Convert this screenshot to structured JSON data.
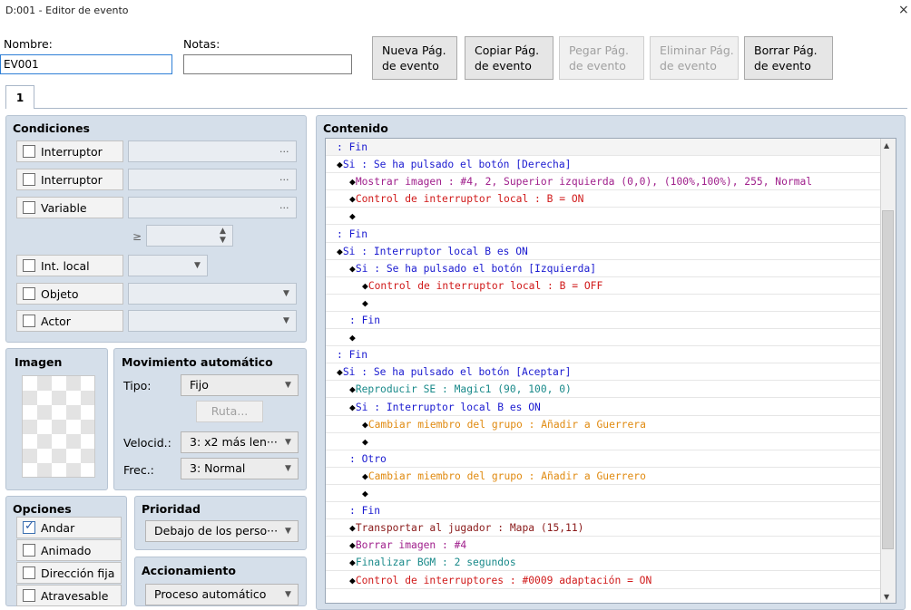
{
  "window": {
    "title": "D:001 - Editor de evento",
    "close": "×"
  },
  "header": {
    "name_label": "Nombre:",
    "name_value": "EV001",
    "notes_label": "Notas:",
    "notes_value": ""
  },
  "page_buttons": [
    {
      "l1": "Nueva Pág.",
      "l2": "de evento",
      "enabled": true
    },
    {
      "l1": "Copiar Pág.",
      "l2": "de evento",
      "enabled": true
    },
    {
      "l1": "Pegar Pág.",
      "l2": "de evento",
      "enabled": false
    },
    {
      "l1": "Eliminar Pág.",
      "l2": "de evento",
      "enabled": false
    },
    {
      "l1": "Borrar Pág.",
      "l2": "de evento",
      "enabled": true
    }
  ],
  "tabs": [
    "1"
  ],
  "conditions": {
    "title": "Condiciones",
    "switch1": "Interruptor",
    "switch2": "Interruptor",
    "variable": "Variable",
    "gte": "≥",
    "self_switch": "Int. local",
    "item": "Objeto",
    "actor": "Actor",
    "ellipsis": "···"
  },
  "image": {
    "title": "Imagen"
  },
  "autonomous": {
    "title": "Movimiento automático",
    "type_label": "Tipo:",
    "type_value": "Fijo",
    "route": "Ruta...",
    "speed_label": "Velocid.:",
    "speed_value": "3: x2 más len···",
    "freq_label": "Frec.:",
    "freq_value": "3: Normal"
  },
  "options": {
    "title": "Opciones",
    "walk": "Andar",
    "walk_checked": true,
    "stepping": "Animado",
    "direction_fix": "Dirección fija",
    "through": "Atravesable"
  },
  "priority": {
    "title": "Prioridad",
    "value": "Debajo de los perso···"
  },
  "trigger": {
    "title": "Accionamiento",
    "value": "Proceso automático"
  },
  "contents": {
    "title": "Contenido",
    "colors": {
      "flow": "#1a1ad0",
      "picture": "#a0208c",
      "switch": "#d01a1a",
      "audio": "#1a8a8a",
      "party": "#e08a10",
      "transfer": "#8a1a1a"
    },
    "rows": [
      {
        "indent": 0,
        "diamond": false,
        "text": ": Fin",
        "color": "flow"
      },
      {
        "indent": 0,
        "diamond": true,
        "text": "Si : Se ha pulsado el botón [Derecha]",
        "color": "flow"
      },
      {
        "indent": 1,
        "diamond": true,
        "text": "Mostrar imagen : #4, 2, Superior izquierda (0,0), (100%,100%), 255, Normal",
        "color": "picture"
      },
      {
        "indent": 1,
        "diamond": true,
        "text": "Control de interruptor local : B = ON",
        "color": "switch"
      },
      {
        "indent": 1,
        "diamond": true,
        "text": "",
        "color": "flow"
      },
      {
        "indent": 0,
        "diamond": false,
        "text": ": Fin",
        "color": "flow"
      },
      {
        "indent": 0,
        "diamond": true,
        "text": "Si : Interruptor local B es ON",
        "color": "flow"
      },
      {
        "indent": 1,
        "diamond": true,
        "text": "Si : Se ha pulsado el botón [Izquierda]",
        "color": "flow"
      },
      {
        "indent": 2,
        "diamond": true,
        "text": "Control de interruptor local : B = OFF",
        "color": "switch"
      },
      {
        "indent": 2,
        "diamond": true,
        "text": "",
        "color": "flow"
      },
      {
        "indent": 1,
        "diamond": false,
        "text": ": Fin",
        "color": "flow"
      },
      {
        "indent": 1,
        "diamond": true,
        "text": "",
        "color": "flow"
      },
      {
        "indent": 0,
        "diamond": false,
        "text": ": Fin",
        "color": "flow"
      },
      {
        "indent": 0,
        "diamond": true,
        "text": "Si : Se ha pulsado el botón [Aceptar]",
        "color": "flow"
      },
      {
        "indent": 1,
        "diamond": true,
        "text": "Reproducir SE : Magic1 (90, 100, 0)",
        "color": "audio"
      },
      {
        "indent": 1,
        "diamond": true,
        "text": "Si : Interruptor local B es ON",
        "color": "flow"
      },
      {
        "indent": 2,
        "diamond": true,
        "text": "Cambiar miembro del grupo : Añadir a Guerrera",
        "color": "party"
      },
      {
        "indent": 2,
        "diamond": true,
        "text": "",
        "color": "flow"
      },
      {
        "indent": 1,
        "diamond": false,
        "text": ": Otro",
        "color": "flow"
      },
      {
        "indent": 2,
        "diamond": true,
        "text": "Cambiar miembro del grupo : Añadir a Guerrero",
        "color": "party"
      },
      {
        "indent": 2,
        "diamond": true,
        "text": "",
        "color": "flow"
      },
      {
        "indent": 1,
        "diamond": false,
        "text": ": Fin",
        "color": "flow"
      },
      {
        "indent": 1,
        "diamond": true,
        "text": "Transportar al jugador : Mapa (15,11)",
        "color": "transfer"
      },
      {
        "indent": 1,
        "diamond": true,
        "text": "Borrar imagen : #4",
        "color": "picture"
      },
      {
        "indent": 1,
        "diamond": true,
        "text": "Finalizar BGM : 2 segundos",
        "color": "audio"
      },
      {
        "indent": 1,
        "diamond": true,
        "text": "Control de interruptores : #0009 adaptación = ON",
        "color": "switch"
      }
    ]
  }
}
